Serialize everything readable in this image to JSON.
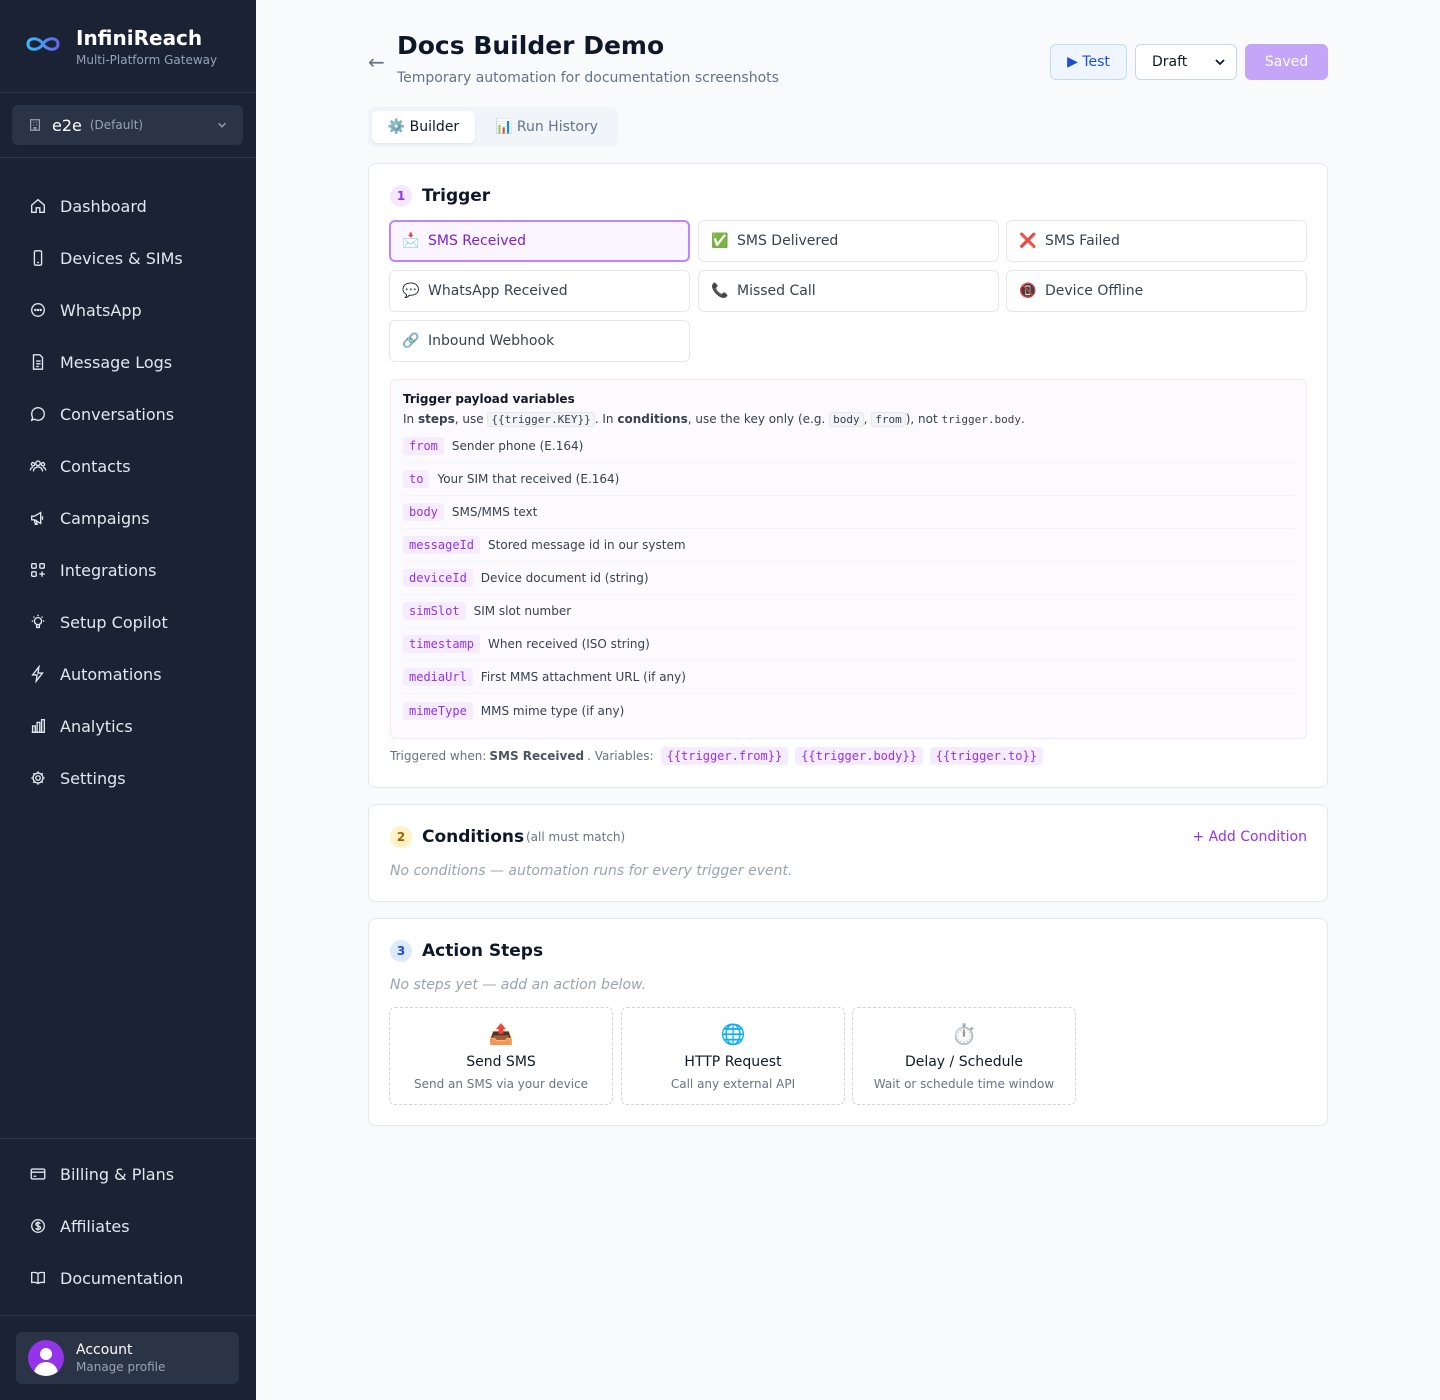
{
  "brand": {
    "name": "InfiniReach",
    "subtitle": "Multi-Platform Gateway"
  },
  "workspace": {
    "name": "e2e",
    "tag": "(Default)"
  },
  "nav": [
    {
      "label": "Dashboard",
      "icon": "home-icon"
    },
    {
      "label": "Devices & SIMs",
      "icon": "phone-icon"
    },
    {
      "label": "WhatsApp",
      "icon": "chat-circle-icon"
    },
    {
      "label": "Message Logs",
      "icon": "document-icon"
    },
    {
      "label": "Conversations",
      "icon": "chat-bubble-icon"
    },
    {
      "label": "Contacts",
      "icon": "users-icon"
    },
    {
      "label": "Campaigns",
      "icon": "megaphone-icon"
    },
    {
      "label": "Integrations",
      "icon": "grid-plus-icon"
    },
    {
      "label": "Setup Copilot",
      "icon": "lightbulb-icon"
    },
    {
      "label": "Automations",
      "icon": "bolt-icon"
    },
    {
      "label": "Analytics",
      "icon": "bar-chart-icon"
    },
    {
      "label": "Settings",
      "icon": "gear-icon"
    }
  ],
  "nav_bottom": [
    {
      "label": "Billing & Plans",
      "icon": "credit-card-icon"
    },
    {
      "label": "Affiliates",
      "icon": "dollar-circle-icon"
    },
    {
      "label": "Documentation",
      "icon": "book-icon"
    }
  ],
  "account": {
    "name": "Account",
    "sub": "Manage profile"
  },
  "header": {
    "back": "←",
    "title": "Docs Builder Demo",
    "subtitle": "Temporary automation for documentation screenshots",
    "test_label": "▶ Test",
    "status_value": "Draft",
    "saved_label": "Saved"
  },
  "tabs": [
    {
      "label": "⚙️ Builder",
      "active": true
    },
    {
      "label": "📊 Run History",
      "active": false
    }
  ],
  "trigger": {
    "num": "1",
    "title": "Trigger",
    "options": [
      {
        "emoji": "📩",
        "label": "SMS Received",
        "selected": true
      },
      {
        "emoji": "✅",
        "label": "SMS Delivered"
      },
      {
        "emoji": "❌",
        "label": "SMS Failed"
      },
      {
        "emoji": "💬",
        "label": "WhatsApp Received"
      },
      {
        "emoji": "📞",
        "label": "Missed Call"
      },
      {
        "emoji": "📵",
        "label": "Device Offline"
      },
      {
        "emoji": "🔗",
        "label": "Inbound Webhook"
      }
    ],
    "payload": {
      "title": "Trigger payload variables",
      "help": {
        "p1": "In ",
        "steps": "steps",
        "p2": ", use ",
        "code1": "{{trigger.KEY}}",
        "p3": ". In ",
        "conditions": "conditions",
        "p4": ", use the key only (e.g. ",
        "code2": "body",
        "p5": ", ",
        "code3": "from",
        "p6": "), not ",
        "code4": "trigger.body",
        "p7": "."
      },
      "variables": [
        {
          "key": "from",
          "desc": "Sender phone (E.164)"
        },
        {
          "key": "to",
          "desc": "Your SIM that received (E.164)"
        },
        {
          "key": "body",
          "desc": "SMS/MMS text"
        },
        {
          "key": "messageId",
          "desc": "Stored message id in our system"
        },
        {
          "key": "deviceId",
          "desc": "Device document id (string)"
        },
        {
          "key": "simSlot",
          "desc": "SIM slot number"
        },
        {
          "key": "timestamp",
          "desc": "When received (ISO string)"
        },
        {
          "key": "mediaUrl",
          "desc": "First MMS attachment URL (if any)"
        },
        {
          "key": "mimeType",
          "desc": "MMS mime type (if any)"
        }
      ]
    },
    "triggered": {
      "prefix": "Triggered when:",
      "event": "SMS Received",
      "vars_label": ". Variables:",
      "chips": [
        "{{trigger.from}}",
        "{{trigger.body}}",
        "{{trigger.to}}"
      ]
    }
  },
  "conditions": {
    "num": "2",
    "title": "Conditions",
    "hint": "(all must match)",
    "add_label": "+ Add Condition",
    "empty": "No conditions — automation runs for every trigger event."
  },
  "actions": {
    "num": "3",
    "title": "Action Steps",
    "empty": "No steps yet — add an action below.",
    "options": [
      {
        "emoji": "📤",
        "title": "Send SMS",
        "desc": "Send an SMS via your device"
      },
      {
        "emoji": "🌐",
        "title": "HTTP Request",
        "desc": "Call any external API"
      },
      {
        "emoji": "⏱️",
        "title": "Delay / Schedule",
        "desc": "Wait or schedule time window"
      }
    ]
  },
  "colors": {
    "sidebar_bg": "#1a2234",
    "accent": "#9333ea",
    "selected_border": "#c084fc",
    "test_blue": "#1d4ed8",
    "saved_bg": "#c4a5f8"
  }
}
